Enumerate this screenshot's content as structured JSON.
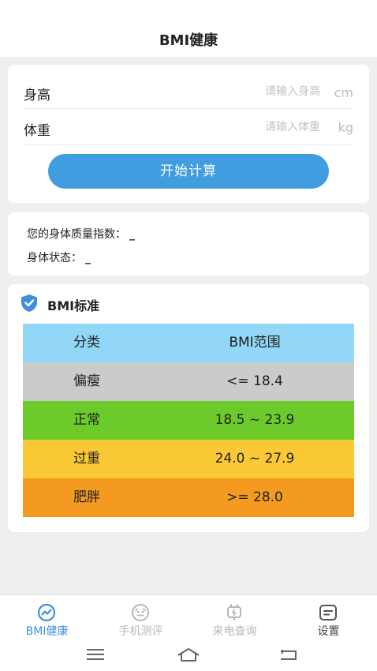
{
  "header": {
    "title": "BMI健康"
  },
  "input": {
    "height_label": "身高",
    "height_placeholder": "请输入身高",
    "height_unit": "cm",
    "weight_label": "体重",
    "weight_placeholder": "请输入体重",
    "weight_unit": "kg",
    "calc_button": "开始计算"
  },
  "result": {
    "index_label": "您的身体质量指数：",
    "index_value": "_",
    "status_label": "身体状态：",
    "status_value": "_"
  },
  "standard": {
    "icon": "shield-check-icon",
    "title": "BMI标准",
    "header": {
      "category": "分类",
      "range": "BMI范围",
      "color": "#92d7f7"
    },
    "rows": [
      {
        "category": "偏瘦",
        "range": "<= 18.4",
        "color": "#cbcbcb"
      },
      {
        "category": "正常",
        "range": "18.5 ~ 23.9",
        "color": "#6ccb2a"
      },
      {
        "category": "过重",
        "range": "24.0 ~ 27.9",
        "color": "#fbc936"
      },
      {
        "category": "肥胖",
        "range": ">= 28.0",
        "color": "#f49a21"
      }
    ]
  },
  "tabbar": [
    {
      "label": "BMI健康",
      "icon": "health-chart-icon",
      "active": true
    },
    {
      "label": "手机测评",
      "icon": "phone-eval-icon",
      "active": false
    },
    {
      "label": "来电查询",
      "icon": "call-query-icon",
      "active": false
    },
    {
      "label": "设置",
      "icon": "settings-icon",
      "active": false
    }
  ],
  "colors": {
    "accent": "#3f9de0",
    "tab_active": "#3f8fe0",
    "tab_inactive": "#b7b7b7"
  }
}
